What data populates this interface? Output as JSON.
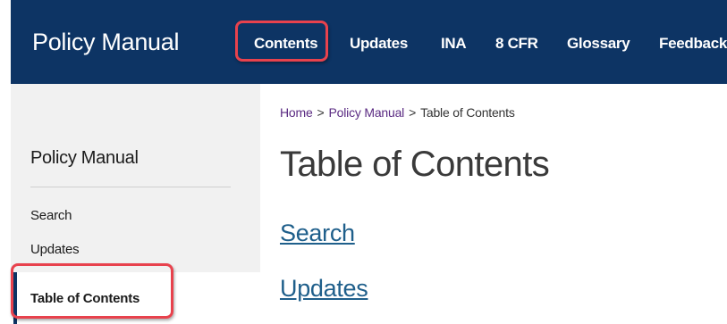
{
  "header": {
    "site_title": "Policy Manual",
    "nav": [
      {
        "label": "Contents"
      },
      {
        "label": "Updates"
      },
      {
        "label": "INA"
      },
      {
        "label": "8 CFR"
      },
      {
        "label": "Glossary"
      },
      {
        "label": "Feedback"
      }
    ]
  },
  "sidebar": {
    "title": "Policy Manual",
    "items": [
      {
        "label": "Search"
      },
      {
        "label": "Updates"
      },
      {
        "label": "Table of Contents"
      }
    ],
    "active_index": 2
  },
  "breadcrumb": {
    "items": [
      "Home",
      "Policy Manual",
      "Table of Contents"
    ],
    "separator": ">"
  },
  "main": {
    "title": "Table of Contents",
    "links": [
      {
        "label": "Search"
      },
      {
        "label": "Updates"
      }
    ]
  },
  "colors": {
    "header_bg": "#0d3464",
    "highlight": "#e8424d",
    "link": "#1f5f8b",
    "breadcrumb_link": "#5a2a82",
    "sidebar_bg": "#f1f1f1"
  }
}
